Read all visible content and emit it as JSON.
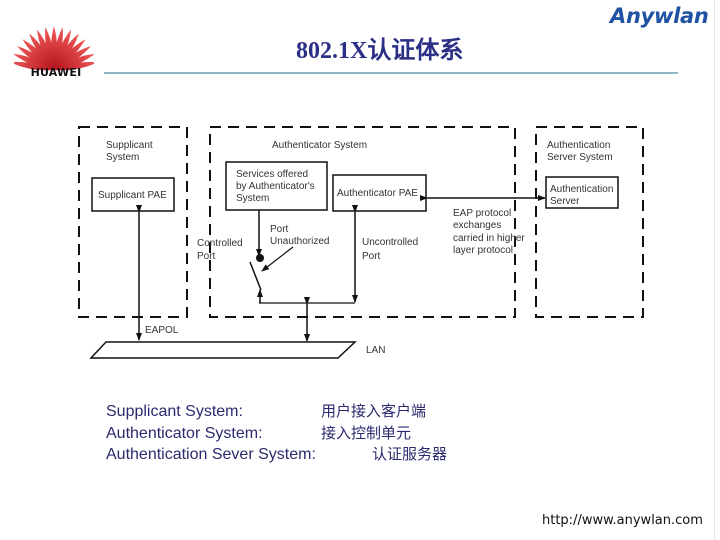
{
  "header": {
    "company_logo_text": "HUAWEI",
    "brand": "Anywlan",
    "title": "802.1X认证体系"
  },
  "diagram": {
    "supplicant_system": {
      "label_line1": "Supplicant",
      "label_line2": "System",
      "pae": "Supplicant PAE"
    },
    "authenticator_system": {
      "label": "Authenticator System",
      "services_line1": "Services offered",
      "services_line2": "by Authenticator's",
      "services_line3": "System",
      "pae": "Authenticator PAE",
      "controlled_port_line1": "Controlled",
      "controlled_port_line2": "Port",
      "port_state_line1": "Port",
      "port_state_line2": "Unauthorized",
      "uncontrolled_port_line1": "Uncontrolled",
      "uncontrolled_port_line2": "Port"
    },
    "eap_note": {
      "line1": "EAP protocol",
      "line2": "exchanges",
      "line3": "carried in higher",
      "line4": "layer protocol"
    },
    "auth_server_system": {
      "label_line1": "Authentication",
      "label_line2": "Server System",
      "server_line1": "Authentication",
      "server_line2": "Server"
    },
    "eapol_label": "EAPOL",
    "lan_label": "LAN"
  },
  "legend": [
    {
      "term": "Supplicant System:",
      "meaning": "用户接入客户端"
    },
    {
      "term": "Authenticator System:",
      "meaning": "接入控制单元"
    },
    {
      "term": "Authentication Sever System:",
      "meaning": "认证服务器"
    }
  ],
  "footer": {
    "url": "http://www.anywlan.com"
  }
}
